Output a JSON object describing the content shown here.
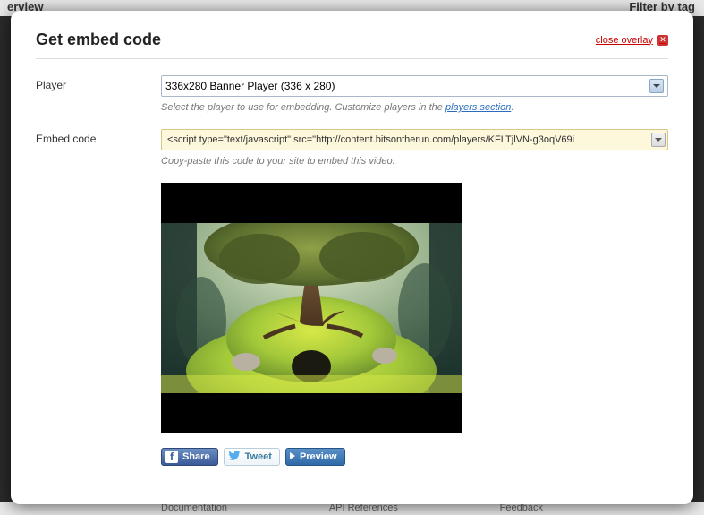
{
  "backdrop": {
    "title_left": "erview",
    "title_right": "Filter by tag",
    "footer_doc": "Documentation",
    "footer_api": "API References",
    "footer_feedback": "Feedback"
  },
  "overlay": {
    "title": "Get embed code",
    "close_label": "close overlay"
  },
  "form": {
    "player_label": "Player",
    "player_value": "336x280 Banner Player (336 x 280)",
    "player_helper_prefix": "Select the player to use for embedding. Customize players in the ",
    "player_helper_link": "players section",
    "player_helper_suffix": ".",
    "embed_label": "Embed code",
    "embed_value": "<script type=\"text/javascript\" src=\"http://content.bitsontherun.com/players/KFLTjlVN-g3oqV69i",
    "embed_helper": "Copy-paste this code to your site to embed this video."
  },
  "buttons": {
    "share": "Share",
    "tweet": "Tweet",
    "preview": "Preview"
  }
}
